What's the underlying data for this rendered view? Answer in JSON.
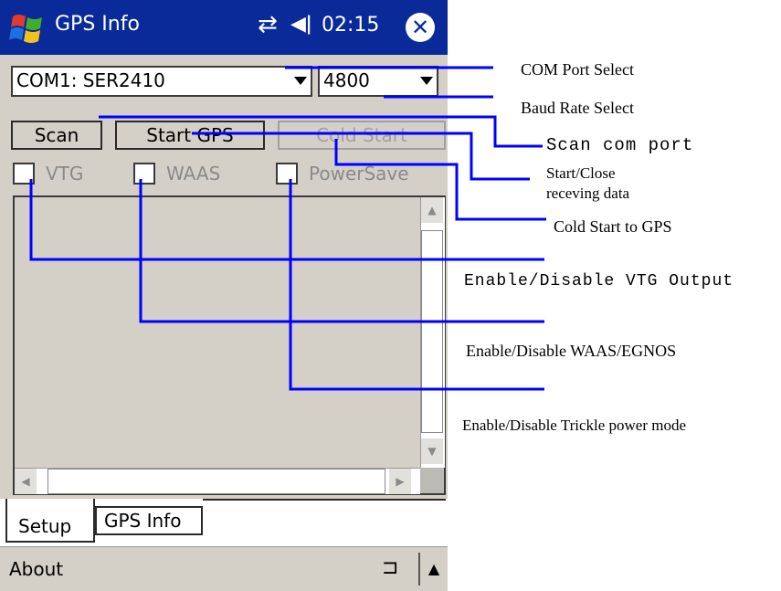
{
  "app": {
    "title": "GPS Info",
    "clock": "02:15"
  },
  "controls": {
    "com_port": "COM1:  SER2410",
    "baud_rate": "4800",
    "scan_label": "Scan",
    "start_label": "Start GPS",
    "cold_start_label": "Cold Start",
    "vtg_label": "VTG",
    "waas_label": "WAAS",
    "powersave_label": "PowerSave"
  },
  "tabs": {
    "setup": "Setup",
    "gps_info": "GPS Info"
  },
  "menubar": {
    "about": "About"
  },
  "annotations": {
    "com_port": "COM Port Select",
    "baud_rate": "Baud Rate Select",
    "scan": "Scan com port",
    "start_line1": "Start/Close",
    "start_line2": "receving data",
    "cold_start": "Cold Start to GPS",
    "vtg": "Enable/Disable VTG Output",
    "waas": "Enable/Disable WAAS/EGNOS",
    "powersave": "Enable/Disable Trickle power mode"
  },
  "colors": {
    "titlebar": "#0a2a9a",
    "callout_line": "#0000ff",
    "panel": "#d4d0c8"
  },
  "icons": [
    "windows-start-icon",
    "sync-icon",
    "speaker-icon",
    "close-icon",
    "keyboard-icon",
    "menu-up-icon"
  ]
}
